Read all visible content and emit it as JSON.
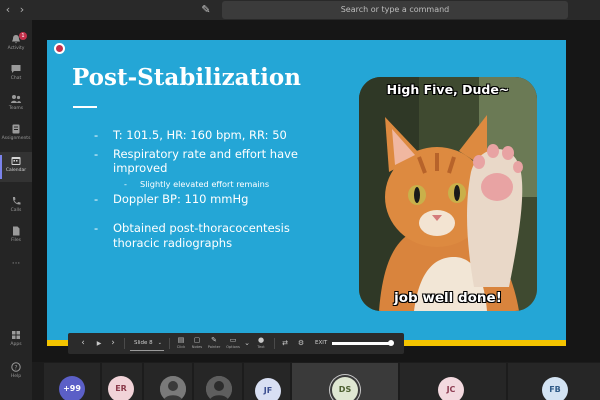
{
  "topbar": {
    "back_arrow": "‹",
    "forward_arrow": "›",
    "compose_icon": "✎",
    "search_placeholder": "Search or type a command"
  },
  "rail": {
    "items": [
      {
        "label": "Activity",
        "icon": "bell-icon",
        "badge": "1"
      },
      {
        "label": "Chat",
        "icon": "chat-icon"
      },
      {
        "label": "Teams",
        "icon": "teams-icon"
      },
      {
        "label": "Assignments",
        "icon": "assignments-icon"
      },
      {
        "label": "Calendar",
        "icon": "calendar-icon",
        "active": true
      },
      {
        "label": "Calls",
        "icon": "phone-icon"
      },
      {
        "label": "Files",
        "icon": "files-icon"
      },
      {
        "label": "···",
        "icon": "more-icon"
      },
      {
        "label": "Apps",
        "icon": "apps-icon"
      },
      {
        "label": "Help",
        "icon": "help-icon"
      }
    ]
  },
  "slide": {
    "title": "Post-Stabilization",
    "bullets": [
      {
        "dash": "-",
        "text": "T: 101.5, HR: 160 bpm, RR: 50"
      },
      {
        "dash": "-",
        "text": "Respiratory rate and effort have"
      },
      {
        "dash": "",
        "text": "improved"
      },
      {
        "dash": "-",
        "text": "Slightly elevated effort remains",
        "sub": true
      },
      {
        "dash": "-",
        "text": "Doppler BP: 110 mmHg"
      },
      {
        "dash": "-",
        "text": "Obtained post-thoracocentesis"
      },
      {
        "dash": "",
        "text": "thoracic radiographs"
      }
    ],
    "meme": {
      "top_text": "High Five, Dude~",
      "bottom_text": "job well done!"
    },
    "colors": {
      "background": "#24a6d6",
      "footer_bar": "#f4c400"
    }
  },
  "toolbar": {
    "prev": "‹",
    "play": "▶",
    "next": "›",
    "slide_label": "Slide 8",
    "slide_chevron": "⌄",
    "tools": [
      {
        "glyph": "▤",
        "label": "Click"
      },
      {
        "glyph": "▢",
        "label": "Notes"
      },
      {
        "glyph": "✎",
        "label": "Pointer"
      },
      {
        "glyph": "▭",
        "label": "Options"
      },
      {
        "glyph": "⌄",
        "label": ""
      },
      {
        "glyph": "●",
        "label": "Text"
      },
      {
        "glyph": "⇄",
        "label": ""
      },
      {
        "glyph": "⚙",
        "label": ""
      }
    ],
    "exit_label": "EXIT",
    "progress": 0.95
  },
  "participants": [
    {
      "initials": "+99",
      "style": "more"
    },
    {
      "initials": "ER",
      "style": "er"
    },
    {
      "initials": "",
      "style": "photo"
    },
    {
      "initials": "",
      "style": "photo"
    },
    {
      "initials": "JF",
      "style": "jf"
    },
    {
      "initials": "DS",
      "style": "ds",
      "speaking": true
    },
    {
      "initials": "JC",
      "style": "jc"
    },
    {
      "initials": "FB",
      "style": "fb"
    }
  ]
}
